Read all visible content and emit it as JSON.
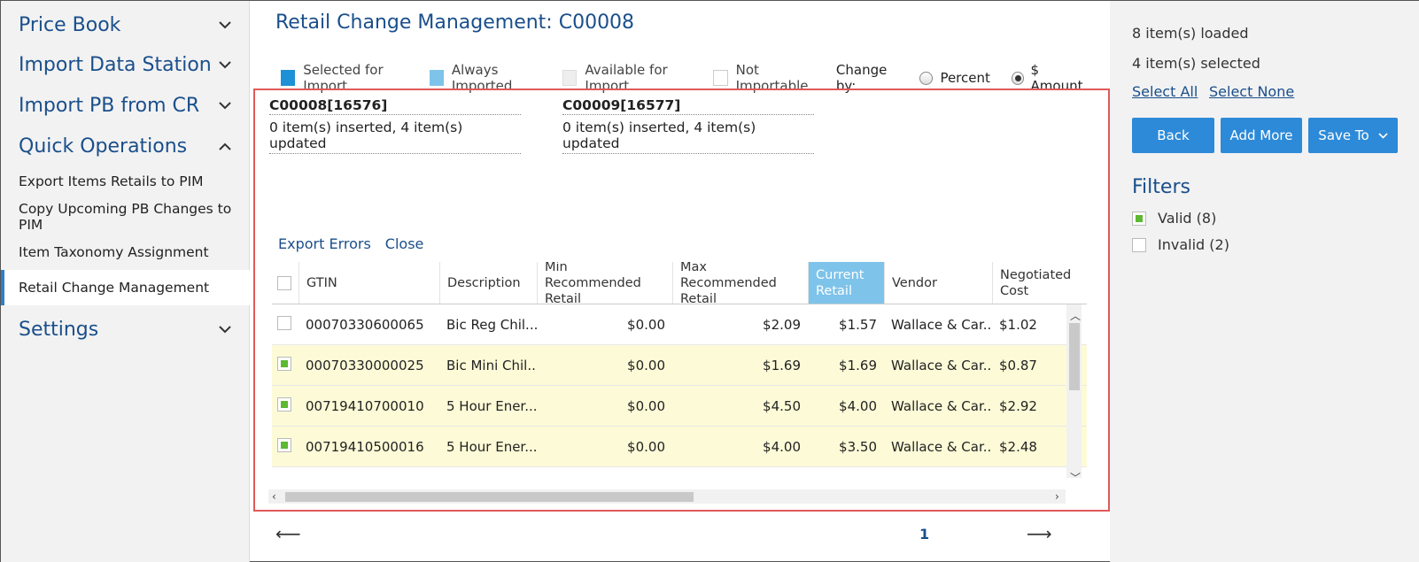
{
  "sidebar": {
    "sections": [
      {
        "label": "Price Book",
        "expanded": false
      },
      {
        "label": "Import Data Station",
        "expanded": false
      },
      {
        "label": "Import PB from CR",
        "expanded": false
      },
      {
        "label": "Quick Operations",
        "expanded": true
      },
      {
        "label": "Settings",
        "expanded": false
      }
    ],
    "sub_items": [
      {
        "label": "Export Items Retails to PIM"
      },
      {
        "label": "Copy Upcoming PB Changes to PIM"
      },
      {
        "label": "Item Taxonomy Assignment"
      },
      {
        "label": "Retail Change Management",
        "active": true
      }
    ]
  },
  "main": {
    "title": "Retail Change Management: C00008",
    "legend": {
      "selected": "Selected for Import",
      "always": "Always Imported",
      "available": "Available for Import",
      "not_importable": "Not Importable",
      "change_by": "Change by:",
      "percent": "Percent",
      "amount": "$ Amount",
      "colors": {
        "selected": "#1e90d6",
        "always": "#7ec3ea",
        "available": "#eeeeee",
        "not_importable": "#ffffff"
      }
    },
    "batches": [
      {
        "title": "C00008[16576]",
        "status": "0 item(s) inserted, 4 item(s) updated"
      },
      {
        "title": "C00009[16577]",
        "status": "0 item(s) inserted, 4 item(s) updated"
      }
    ],
    "export_errors": "Export Errors",
    "close": "Close",
    "table": {
      "headers": [
        "GTIN",
        "Description",
        "Min Recommended Retail",
        "Max Recommended Retail",
        "Current Retail",
        "Vendor",
        "Negotiated Cost"
      ],
      "rows": [
        {
          "checked": false,
          "gtin": "00070330600065",
          "desc": "Bic Reg Chil...",
          "min": "$0.00",
          "max": "$2.09",
          "current": "$1.57",
          "vendor": "Wallace & Car...",
          "cost": "$1.02"
        },
        {
          "checked": true,
          "gtin": "00070330000025",
          "desc": "Bic Mini Chil...",
          "min": "$0.00",
          "max": "$1.69",
          "current": "$1.69",
          "vendor": "Wallace & Car...",
          "cost": "$0.87"
        },
        {
          "checked": true,
          "gtin": "00719410700010",
          "desc": "5 Hour Ener...",
          "min": "$0.00",
          "max": "$4.50",
          "current": "$4.00",
          "vendor": "Wallace & Car...",
          "cost": "$2.92"
        },
        {
          "checked": true,
          "gtin": "00719410500016",
          "desc": "5 Hour Ener...",
          "min": "$0.00",
          "max": "$4.00",
          "current": "$3.50",
          "vendor": "Wallace & Car...",
          "cost": "$2.48"
        }
      ]
    },
    "pager": {
      "page": "1"
    }
  },
  "right": {
    "loaded": "8 item(s) loaded",
    "selected": "4 item(s) selected",
    "select_all": "Select All",
    "select_none": "Select None",
    "back": "Back",
    "add_more": "Add More",
    "save_to": "Save To",
    "filters_title": "Filters",
    "filters": [
      {
        "label": "Valid (8)",
        "checked": true
      },
      {
        "label": "Invalid (2)",
        "checked": false
      }
    ]
  }
}
